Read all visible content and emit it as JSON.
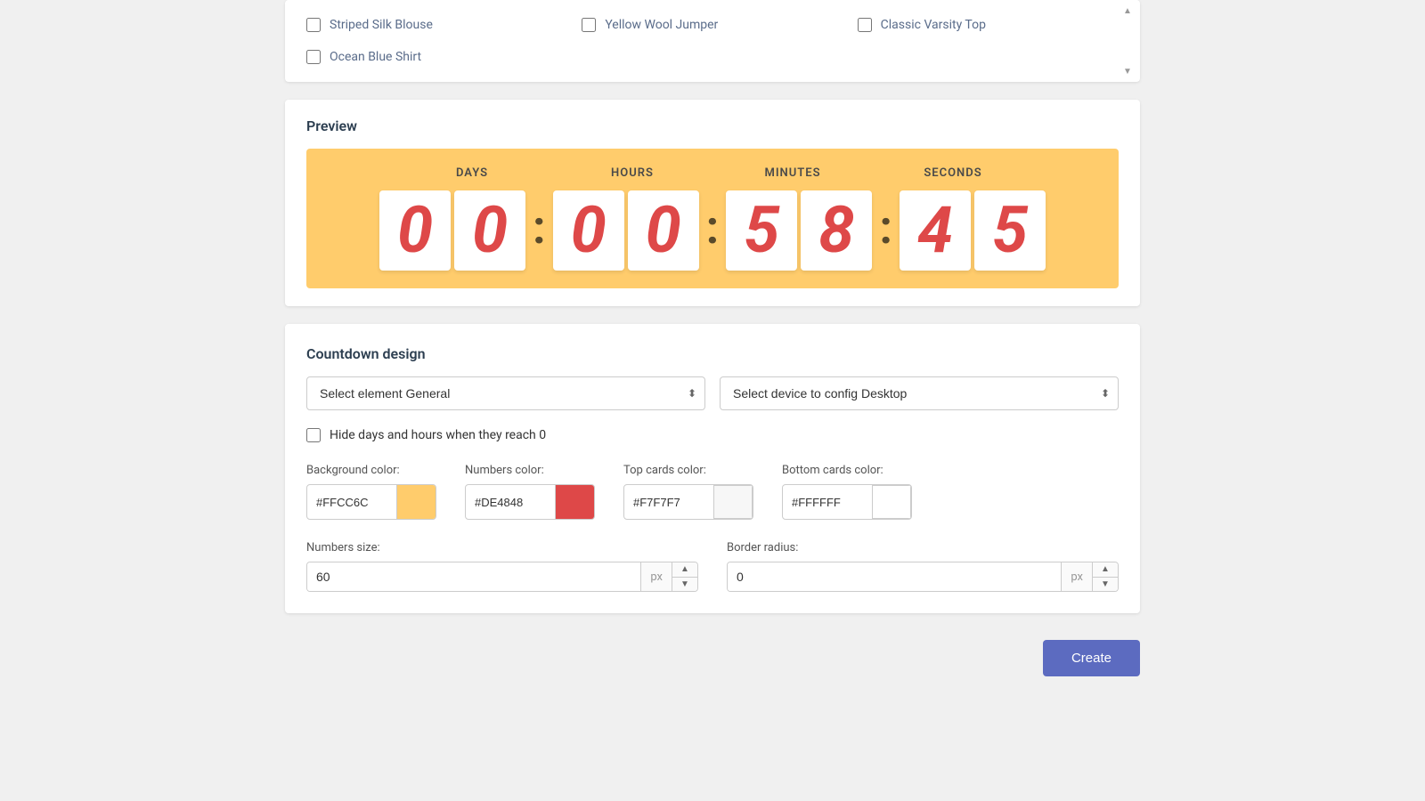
{
  "products": {
    "items": [
      {
        "id": "striped-silk-blouse",
        "label": "Striped Silk Blouse",
        "checked": false
      },
      {
        "id": "yellow-wool-jumper",
        "label": "Yellow Wool Jumper",
        "checked": false
      },
      {
        "id": "classic-varsity-top",
        "label": "Classic Varsity Top",
        "checked": false
      },
      {
        "id": "ocean-blue-shirt",
        "label": "Ocean Blue Shirt",
        "checked": false
      }
    ]
  },
  "preview": {
    "title": "Preview",
    "labels": {
      "days": "DAYS",
      "hours": "HOURS",
      "minutes": "MINUTES",
      "seconds": "SECONDS"
    },
    "digits": {
      "days": [
        "0",
        "0"
      ],
      "hours": [
        "0",
        "0"
      ],
      "minutes": [
        "5",
        "8"
      ],
      "seconds": [
        "4",
        "5"
      ]
    },
    "separator": ":"
  },
  "design": {
    "title": "Countdown design",
    "select_element_label": "Select element",
    "select_element_value": "General",
    "select_device_label": "Select device to config",
    "select_device_value": "Desktop",
    "hide_days_label": "Hide days and hours when they reach 0",
    "hide_days_checked": false,
    "colors": {
      "background": {
        "label": "Background color:",
        "hex": "#FFCC6C",
        "swatch": "#FFCC6C"
      },
      "numbers": {
        "label": "Numbers color:",
        "hex": "#DE4848",
        "swatch": "#DE4848"
      },
      "top_cards": {
        "label": "Top cards color:",
        "hex": "#F7F7F7",
        "swatch": "#F7F7F7"
      },
      "bottom_cards": {
        "label": "Bottom cards color:",
        "hex": "#FFFFFF",
        "swatch": "#FFFFFF"
      }
    },
    "numbers_size": {
      "label": "Numbers size:",
      "value": "60",
      "unit": "px"
    },
    "border_radius": {
      "label": "Border radius:",
      "value": "0",
      "unit": "px"
    }
  },
  "buttons": {
    "create": "Create"
  }
}
